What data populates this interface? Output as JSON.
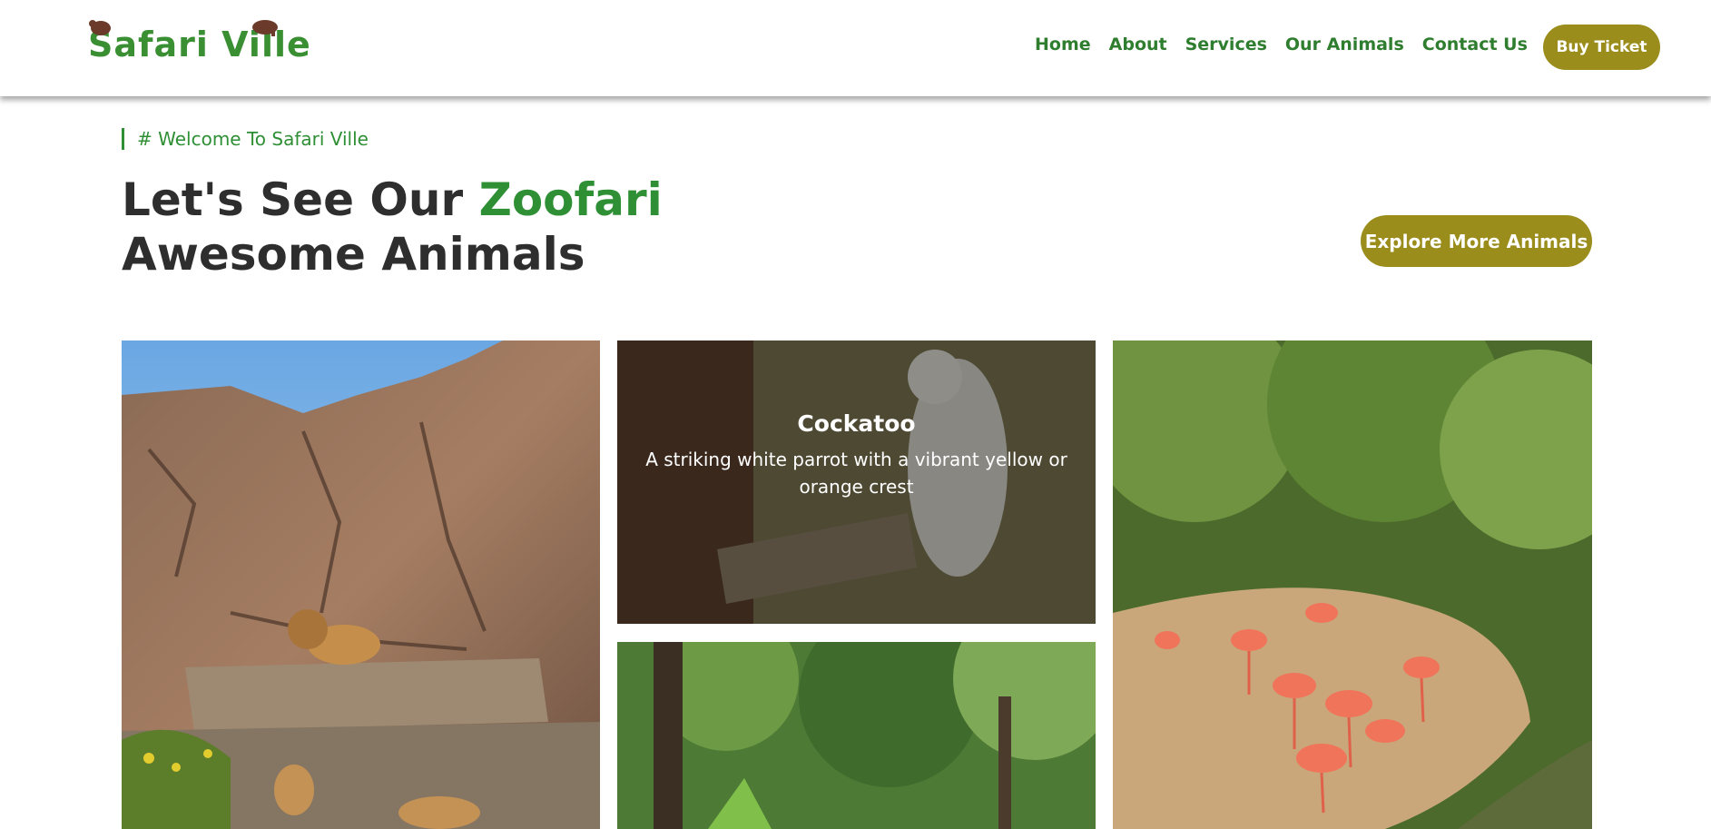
{
  "header": {
    "logo_text": "Safari Ville",
    "nav": [
      {
        "label": "Home"
      },
      {
        "label": "About"
      },
      {
        "label": "Services"
      },
      {
        "label": "Our Animals"
      },
      {
        "label": "Contact Us"
      }
    ],
    "buy_ticket_label": "Buy Ticket"
  },
  "section": {
    "eyebrow": "# Welcome To Safari Ville",
    "headline_part1": "Let's See Our ",
    "headline_accent": "Zoofari",
    "headline_part2": "Awesome Animals",
    "explore_label": "Explore More Animals"
  },
  "gallery": {
    "featured": {
      "title": "Cockatoo",
      "description": "A striking white parrot with a vibrant yellow or orange crest"
    }
  },
  "colors": {
    "brand_green": "#2f8f35",
    "button_olive": "#9a8d1c",
    "heading_dark": "#2e2e2e"
  }
}
